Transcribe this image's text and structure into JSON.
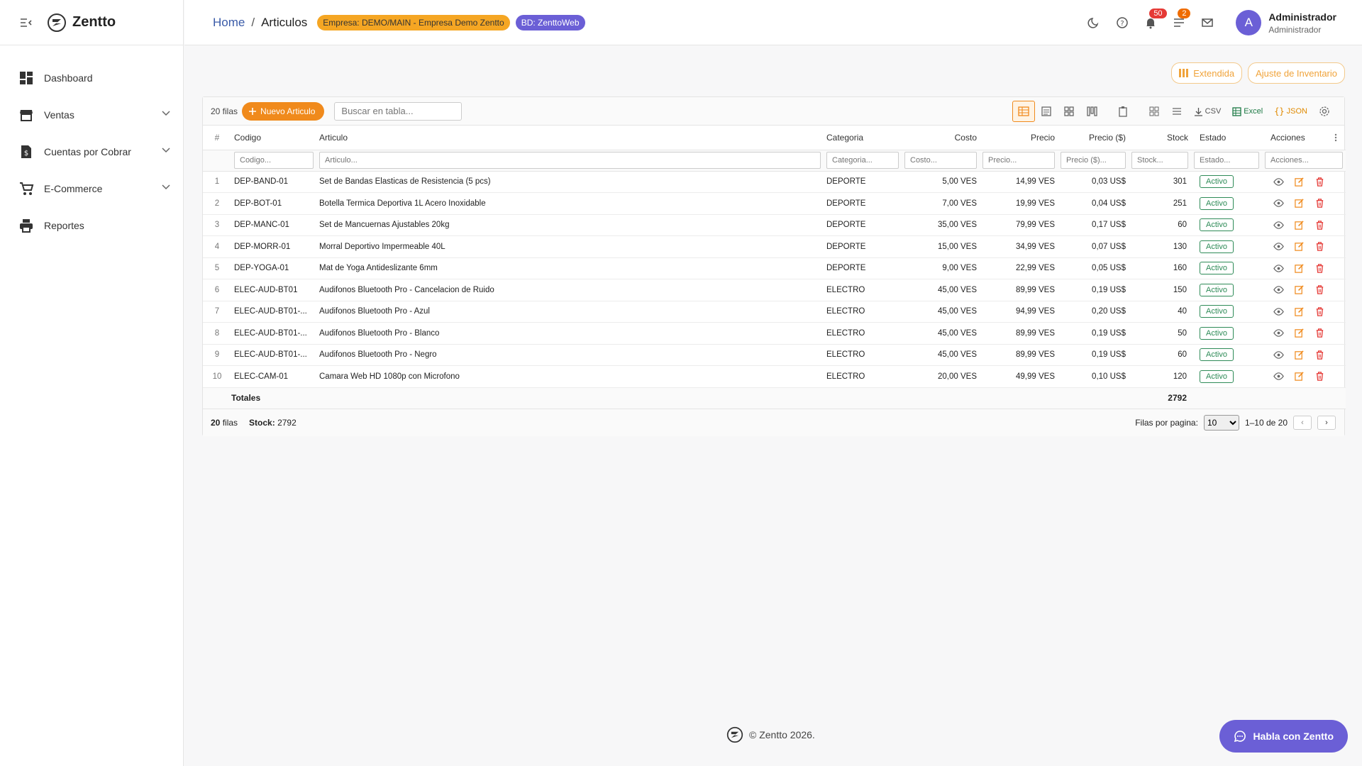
{
  "app": {
    "name": "Zentto"
  },
  "sidebar": {
    "items": [
      {
        "label": "Dashboard",
        "icon": "dashboard-icon",
        "expandable": false
      },
      {
        "label": "Ventas",
        "icon": "store-icon",
        "expandable": true
      },
      {
        "label": "Cuentas por Cobrar",
        "icon": "invoice-dollar-icon",
        "expandable": true
      },
      {
        "label": "E-Commerce",
        "icon": "shopping-cart-icon",
        "expandable": true
      },
      {
        "label": "Reportes",
        "icon": "printer-icon",
        "expandable": false
      }
    ]
  },
  "header": {
    "breadcrumb_home": "Home",
    "breadcrumb_sep": "/",
    "breadcrumb_current": "Articulos",
    "empresa_badge": "Empresa: DEMO/MAIN - Empresa Demo Zentto",
    "bd_badge": "BD: ZenttoWeb",
    "notifications_count": "50",
    "tasks_count": "2",
    "avatar_letter": "A",
    "user_name": "Administrador",
    "user_role": "Administrador"
  },
  "actions": {
    "extendida": "Extendida",
    "ajuste": "Ajuste de Inventario"
  },
  "toolbar": {
    "rows_count": "20 filas",
    "new_button": "Nuevo Articulo",
    "search_placeholder": "Buscar en tabla...",
    "csv": "CSV",
    "excel": "Excel",
    "json": "JSON"
  },
  "table": {
    "columns": {
      "num": "#",
      "codigo": "Codigo",
      "articulo": "Articulo",
      "categoria": "Categoria",
      "costo": "Costo",
      "precio": "Precio",
      "precio_usd": "Precio ($)",
      "stock": "Stock",
      "estado": "Estado",
      "acciones": "Acciones"
    },
    "filters": {
      "codigo": "Codigo...",
      "articulo": "Articulo...",
      "categoria": "Categoria...",
      "costo": "Costo...",
      "precio": "Precio...",
      "precio_usd": "Precio ($)...",
      "stock": "Stock...",
      "estado": "Estado...",
      "acciones": "Acciones..."
    },
    "rows": [
      {
        "n": "1",
        "codigo": "DEP-BAND-01",
        "articulo": "Set de Bandas Elasticas de Resistencia (5 pcs)",
        "categoria": "DEPORTE",
        "costo": "5,00 VES",
        "precio": "14,99 VES",
        "precio_usd": "0,03 US$",
        "stock": "301",
        "estado": "Activo"
      },
      {
        "n": "2",
        "codigo": "DEP-BOT-01",
        "articulo": "Botella Termica Deportiva 1L Acero Inoxidable",
        "categoria": "DEPORTE",
        "costo": "7,00 VES",
        "precio": "19,99 VES",
        "precio_usd": "0,04 US$",
        "stock": "251",
        "estado": "Activo"
      },
      {
        "n": "3",
        "codigo": "DEP-MANC-01",
        "articulo": "Set de Mancuernas Ajustables 20kg",
        "categoria": "DEPORTE",
        "costo": "35,00 VES",
        "precio": "79,99 VES",
        "precio_usd": "0,17 US$",
        "stock": "60",
        "estado": "Activo"
      },
      {
        "n": "4",
        "codigo": "DEP-MORR-01",
        "articulo": "Morral Deportivo Impermeable 40L",
        "categoria": "DEPORTE",
        "costo": "15,00 VES",
        "precio": "34,99 VES",
        "precio_usd": "0,07 US$",
        "stock": "130",
        "estado": "Activo"
      },
      {
        "n": "5",
        "codigo": "DEP-YOGA-01",
        "articulo": "Mat de Yoga Antideslizante 6mm",
        "categoria": "DEPORTE",
        "costo": "9,00 VES",
        "precio": "22,99 VES",
        "precio_usd": "0,05 US$",
        "stock": "160",
        "estado": "Activo"
      },
      {
        "n": "6",
        "codigo": "ELEC-AUD-BT01",
        "articulo": "Audifonos Bluetooth Pro - Cancelacion de Ruido",
        "categoria": "ELECTRO",
        "costo": "45,00 VES",
        "precio": "89,99 VES",
        "precio_usd": "0,19 US$",
        "stock": "150",
        "estado": "Activo"
      },
      {
        "n": "7",
        "codigo": "ELEC-AUD-BT01-...",
        "articulo": "Audifonos Bluetooth Pro - Azul",
        "categoria": "ELECTRO",
        "costo": "45,00 VES",
        "precio": "94,99 VES",
        "precio_usd": "0,20 US$",
        "stock": "40",
        "estado": "Activo"
      },
      {
        "n": "8",
        "codigo": "ELEC-AUD-BT01-...",
        "articulo": "Audifonos Bluetooth Pro - Blanco",
        "categoria": "ELECTRO",
        "costo": "45,00 VES",
        "precio": "89,99 VES",
        "precio_usd": "0,19 US$",
        "stock": "50",
        "estado": "Activo"
      },
      {
        "n": "9",
        "codigo": "ELEC-AUD-BT01-...",
        "articulo": "Audifonos Bluetooth Pro - Negro",
        "categoria": "ELECTRO",
        "costo": "45,00 VES",
        "precio": "89,99 VES",
        "precio_usd": "0,19 US$",
        "stock": "60",
        "estado": "Activo"
      },
      {
        "n": "10",
        "codigo": "ELEC-CAM-01",
        "articulo": "Camara Web HD 1080p con Microfono",
        "categoria": "ELECTRO",
        "costo": "20,00 VES",
        "precio": "49,99 VES",
        "precio_usd": "0,10 US$",
        "stock": "120",
        "estado": "Activo"
      }
    ],
    "totals_label": "Totales",
    "totals_stock": "2792"
  },
  "footer": {
    "rows": "20",
    "rows_word": "filas",
    "stock_label": "Stock:",
    "stock_value": "2792",
    "per_page_label": "Filas por pagina:",
    "per_page_value": "10",
    "range": "1–10 de 20",
    "prev": "‹",
    "next": "›"
  },
  "copyright": "© Zentto 2026.",
  "chat_button": "Habla con Zentto",
  "colors": {
    "accent": "#f08a1c",
    "brand": "#6b5fd6",
    "status": "#2e8b57",
    "link": "#3a5ba8"
  }
}
